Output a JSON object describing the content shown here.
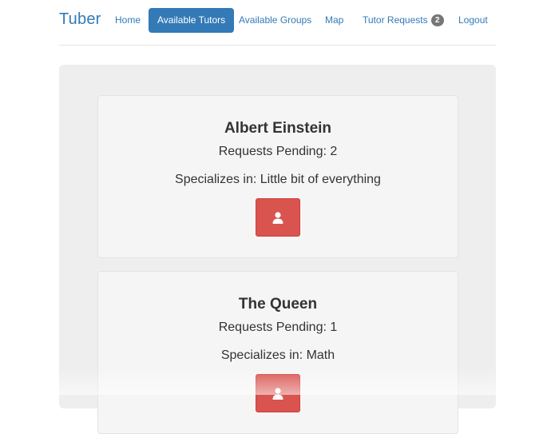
{
  "navbar": {
    "brand": "Tuber",
    "items": [
      {
        "label": "Home"
      },
      {
        "label": "Available Tutors"
      },
      {
        "label": "Available Groups"
      },
      {
        "label": "Map"
      },
      {
        "label": "Tutor Requests",
        "badge": "2"
      },
      {
        "label": "Logout"
      }
    ],
    "active_item": "Available Tutors"
  },
  "tutors": [
    {
      "name": "Albert Einstein",
      "pending": "Requests Pending: 2",
      "specializes": "Specializes in: Little bit of everything",
      "button_icon": "user-icon"
    },
    {
      "name": "The Queen",
      "pending": "Requests Pending: 1",
      "specializes": "Specializes in: Math",
      "button_icon": "user-icon"
    }
  ],
  "colors": {
    "primary": "#337ab7",
    "danger": "#d9534f",
    "jumbotron": "#eeeeee",
    "card": "#f5f5f5",
    "badge": "#777777"
  }
}
